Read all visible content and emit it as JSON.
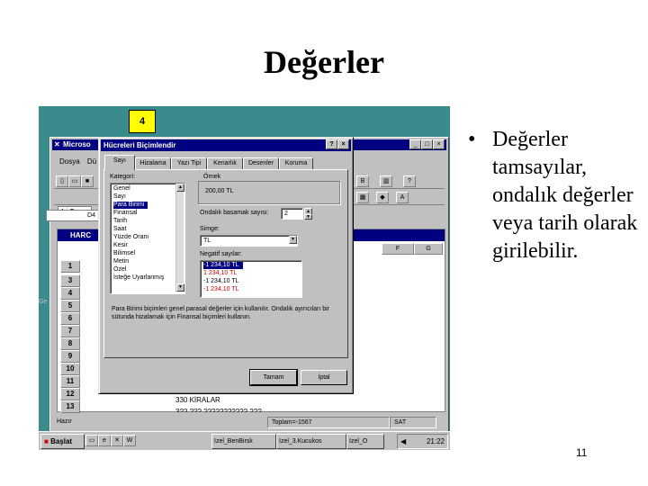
{
  "slide": {
    "title": "Değerler",
    "bullet_glyph": "•",
    "bullet_text": "Değerler tamsayılar, ondalık değerler veya tarih olarak girilebilir.",
    "slide_number": "11"
  },
  "excel": {
    "title": "Microso",
    "menu": [
      "Dosya",
      "Dü"
    ],
    "font_name": "Ari-Tur",
    "cell_ref": "D4",
    "workbook_title": "HARC",
    "columns": [
      "F",
      "G"
    ],
    "rows": [
      "1",
      "3",
      "4",
      "5",
      "6",
      "7",
      "8",
      "9",
      "10",
      "11",
      "12",
      "13"
    ],
    "cell_texts": [
      "330 KİRALAR",
      "3?? ??? ??????????? ???"
    ],
    "status_sum": "Toplam=-1567",
    "status_mode": "SAT",
    "sheet_label": "Hazır",
    "desktop_label": "Ge"
  },
  "dialog": {
    "title": "Hücreleri Biçimlendir",
    "help_glyph": "?",
    "close_glyph": "×",
    "tabs": [
      "Sayı",
      "Hizalama",
      "Yazı Tipi",
      "Kenarlık",
      "Desenler",
      "Koruma"
    ],
    "category_label": "Kategori:",
    "categories": [
      "Genel",
      "Sayı",
      "Para Birimi",
      "Finansal",
      "Tarih",
      "Saat",
      "Yüzde Oranı",
      "Kesir",
      "Bilimsel",
      "Metin",
      "Özel",
      "İsteğe Uyarlanmış"
    ],
    "selected_category": "Para Birimi",
    "sample_label": "Örnek",
    "sample_value": "200,00 TL",
    "decimals_label": "Ondalık basamak sayısı:",
    "decimals_value": "2",
    "symbol_label": "Simge:",
    "symbol_value": "TL",
    "negative_label": "Negatif sayılar:",
    "negative_options": [
      "-1 234,10 TL",
      "1 234,10 TL",
      "-1 234,10 TL",
      "-1 234,10 TL"
    ],
    "description": "Para Birimi biçimleri genel parasal değerler için kullanılır. Ondalık ayırıcıları bir sütunda hizalamak için Finansal biçimleri kullanın.",
    "ok_label": "Tamam",
    "cancel_label": "İptal"
  },
  "taskbar": {
    "start_label": "Başlat",
    "tasks": [
      "Izel_BenBirsk",
      "Izel_3.Kucukos",
      "Izel_O"
    ],
    "clock": "21:22"
  },
  "colors": {
    "titlebar": "#000080",
    "desktop": "#3a8c8c",
    "chrome": "#c0c0c0"
  }
}
